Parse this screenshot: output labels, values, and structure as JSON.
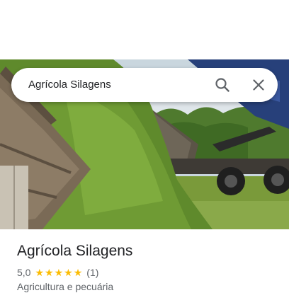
{
  "search": {
    "query": "Agrícola Silagens"
  },
  "icons": {
    "search": "search-icon",
    "close": "close-icon",
    "star": "star-icon"
  },
  "place": {
    "name": "Agrícola Silagens",
    "rating": "5,0",
    "stars_filled": 5,
    "stars_total": 5,
    "review_count": "(1)",
    "category": "Agricultura e pecuária"
  },
  "colors": {
    "star": "#fbbc04",
    "text_primary": "#202124",
    "text_secondary": "#5f6368"
  }
}
